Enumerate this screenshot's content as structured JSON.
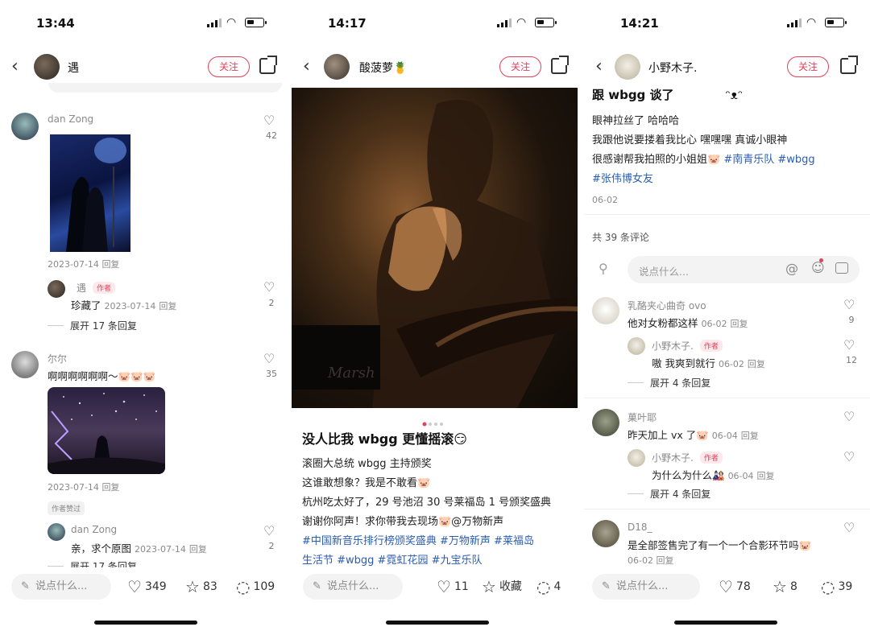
{
  "phones": [
    {
      "status_time": "13:44",
      "author": "遇",
      "follow_label": "关注",
      "comments": [
        {
          "name": "dan Zong",
          "likes": "42",
          "date": "2023-07-14",
          "reply": "回复"
        },
        {
          "name": "遇",
          "badge": "作者",
          "text": "珍藏了",
          "date": "2023-07-14",
          "reply": "回复",
          "likes": "2"
        },
        {
          "expand": "展开 17 条回复"
        },
        {
          "name": "尔尔",
          "text": "啊啊啊啊啊啊～",
          "likes": "35",
          "date": "2023-07-14",
          "reply": "回复",
          "badge2": "作者赞过"
        },
        {
          "name": "dan Zong",
          "text": "亲，求个原图",
          "date": "2023-07-14",
          "reply": "回复",
          "likes": "2"
        },
        {
          "expand": "展开 17 条回复"
        }
      ],
      "bottom": {
        "placeholder": "说点什么...",
        "likes": "349",
        "stars": "83",
        "comments": "109"
      }
    },
    {
      "status_time": "14:17",
      "author": "酸菠萝🍍",
      "follow_label": "关注",
      "post_title": "没人比我 wbgg 更懂摇滚😏",
      "lines": [
        "滚圈大总统 wbgg 主持颁奖",
        "这谁敢想象？我是不敢看🐷",
        "杭州吃太好了，29 号池沼 30 号莱福岛 1 号颁奖盛典",
        "谢谢你阿声！求你带我去现场🐷@万物新声"
      ],
      "tags_line1": "#中国新音乐排行榜颁奖盛典  #万物新声  #莱福岛",
      "tags_line2": "生活节  #wbgg  #霓虹花园  #九宝乐队",
      "bottom": {
        "placeholder": "说点什么...",
        "likes": "11",
        "stars": "收藏",
        "comments": "4"
      }
    },
    {
      "status_time": "14:21",
      "author": "小野木子.",
      "follow_label": "关注",
      "post_title": "跟 wbgg 谈了",
      "post_title_emoji": "ᵔᴥᵔ",
      "lines": [
        "眼神拉丝了 哈哈哈",
        "我跟他说要搂着我比心 嘿嘿嘿 真诚小眼神"
      ],
      "line3_text": "很感谢帮我拍照的小姐姐🐷",
      "line3_tags": "#南青乐队  #wbgg",
      "line4_tag": "#张伟博女友",
      "post_date": "06-02",
      "comment_count": "共 39 条评论",
      "input_placeholder": "说点什么...",
      "comments": [
        {
          "name": "乳酪夹心曲奇 ovo",
          "text": "他对女粉都这样",
          "date": "06-02",
          "reply": "回复",
          "likes": "9"
        },
        {
          "name": "小野木子.",
          "badge": "作者",
          "text": "嗷 我爽到就行",
          "date": "06-02",
          "reply": "回复",
          "likes": "12"
        },
        {
          "expand": "展开 4 条回复"
        },
        {
          "name": "菓叶耶",
          "text": "昨天加上 vx 了🐷",
          "date": "06-04",
          "reply": "回复"
        },
        {
          "name": "小野木子.",
          "badge": "作者",
          "text": "为什么为什么🎎",
          "date": "06-04",
          "reply": "回复"
        },
        {
          "expand": "展开 4 条回复"
        },
        {
          "name": "D18_",
          "text": "是全部签售完了有一个一个合影环节吗🐷",
          "date": "06-02",
          "reply": "回复"
        }
      ],
      "bottom": {
        "placeholder": "说点什么...",
        "likes": "78",
        "stars": "8",
        "comments": "39"
      }
    }
  ],
  "icons": {
    "back": "chevron-left-icon",
    "share": "share-icon",
    "heart": "heart-icon",
    "star": "star-icon",
    "comment": "comment-icon",
    "pen": "pen-icon"
  },
  "colors": {
    "accent": "#e0425a",
    "tag": "#2a5db0"
  }
}
